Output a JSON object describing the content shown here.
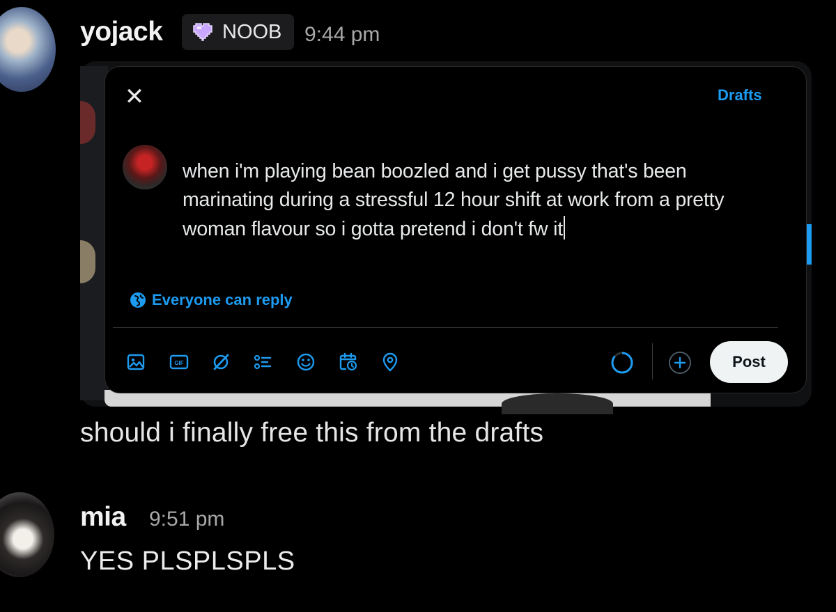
{
  "messages": [
    {
      "username": "yojack",
      "badge": "NOOB",
      "time": "9:44 pm",
      "text": "should i finally free this from the drafts"
    },
    {
      "username": "mia",
      "time": "9:51 pm",
      "text": "YES PLSPLSPLS"
    }
  ],
  "compose": {
    "drafts_label": "Drafts",
    "text": "when i'm playing bean boozled and i get pussy that's been marinating during a stressful 12 hour shift at work from a pretty woman flavour so i gotta pretend i don't fw it",
    "reply_setting": "Everyone can reply",
    "post_label": "Post",
    "toolbar_icons": [
      "image-icon",
      "gif-icon",
      "grok-icon",
      "poll-icon",
      "emoji-icon",
      "schedule-icon",
      "location-icon"
    ],
    "accent_color": "#1d9bf0"
  },
  "colors": {
    "background": "#000000",
    "badge_bg": "#1c1c1f",
    "timestamp": "#a8a8a8",
    "accent": "#1d9bf0"
  }
}
